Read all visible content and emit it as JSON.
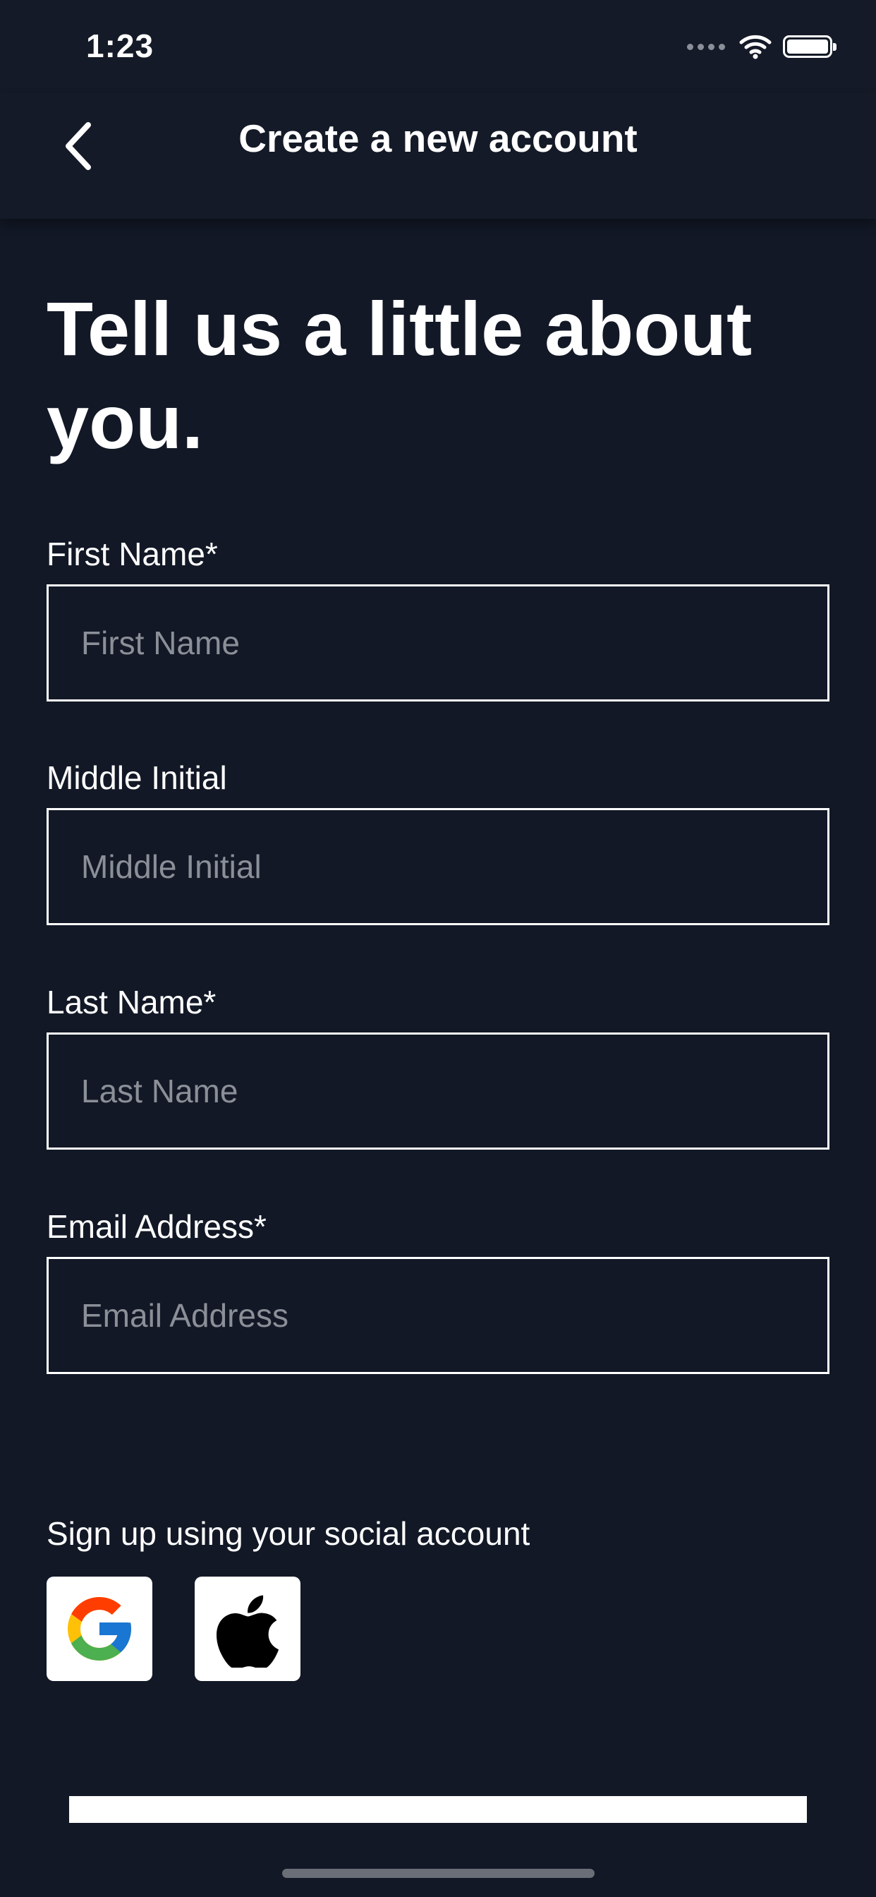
{
  "status_bar": {
    "time": "1:23"
  },
  "header": {
    "title": "Create a new account",
    "back_icon": "chevron-left-icon"
  },
  "heading": "Tell us a little about you.",
  "form": {
    "fields": [
      {
        "label": "First Name*",
        "placeholder": "First Name",
        "value": ""
      },
      {
        "label": "Middle Initial",
        "placeholder": "Middle Initial",
        "value": ""
      },
      {
        "label": "Last Name*",
        "placeholder": "Last Name",
        "value": ""
      },
      {
        "label": "Email Address*",
        "placeholder": "Email Address",
        "value": ""
      }
    ]
  },
  "social": {
    "label": "Sign up using your social account",
    "providers": [
      {
        "icon": "google-icon"
      },
      {
        "icon": "apple-icon"
      }
    ]
  },
  "colors": {
    "background": "#121826",
    "text": "#ffffff",
    "placeholder": "#8b8f97",
    "google_blue": "#4285F4",
    "google_red": "#EA4335",
    "google_yellow": "#FBBC05",
    "google_green": "#34A853"
  }
}
